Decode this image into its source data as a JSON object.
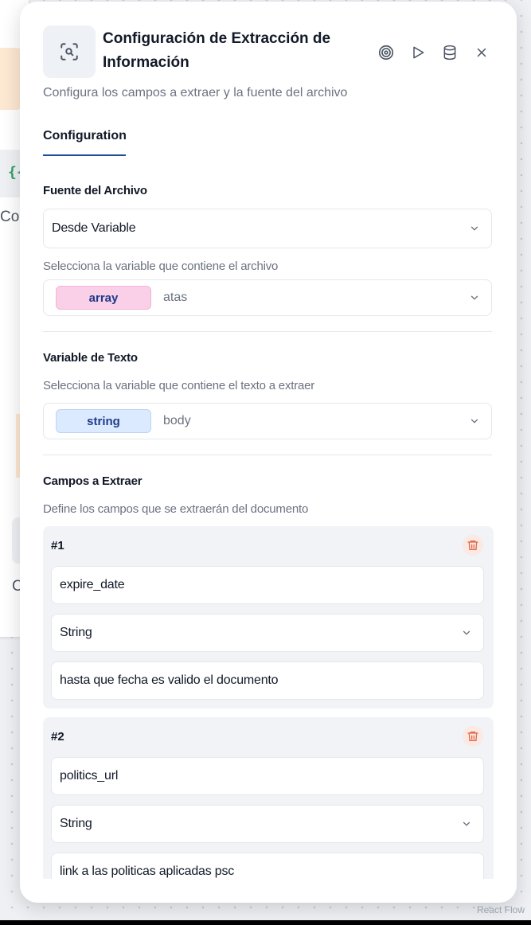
{
  "panel": {
    "title": "Configuración de Extracción de Información",
    "subtitle": "Configura los campos a extraer y la fuente del archivo",
    "tabs": [
      "Configuration"
    ],
    "actions": [
      "target-icon",
      "play-icon",
      "database-icon",
      "close-icon"
    ]
  },
  "file_source": {
    "label": "Fuente del Archivo",
    "selected": "Desde Variable",
    "helper": "Selecciona la variable que contiene el archivo",
    "variable": {
      "type": "array",
      "name": "atas"
    }
  },
  "text_variable": {
    "label": "Variable de Texto",
    "helper": "Selecciona la variable que contiene el texto a extraer",
    "variable": {
      "type": "string",
      "name": "body"
    }
  },
  "fields": {
    "label": "Campos a Extraer",
    "helper": "Define los campos que se extraerán del documento",
    "items": [
      {
        "number": "#1",
        "name": "expire_date",
        "type": "String",
        "description": "hasta que fecha es valido el documento"
      },
      {
        "number": "#2",
        "name": "politics_url",
        "type": "String",
        "description": "link a las politicas aplicadas psc"
      }
    ]
  },
  "background": {
    "var_fragment": "{{",
    "label_fragment_1": "Cor",
    "label_fragment_2": "C"
  },
  "footer": {
    "attribution": "React Flow"
  },
  "colors": {
    "accent": "#1f4e99",
    "array_chip": "#f9d0e8",
    "string_chip": "#dbeafe",
    "danger": "#e0694a"
  }
}
